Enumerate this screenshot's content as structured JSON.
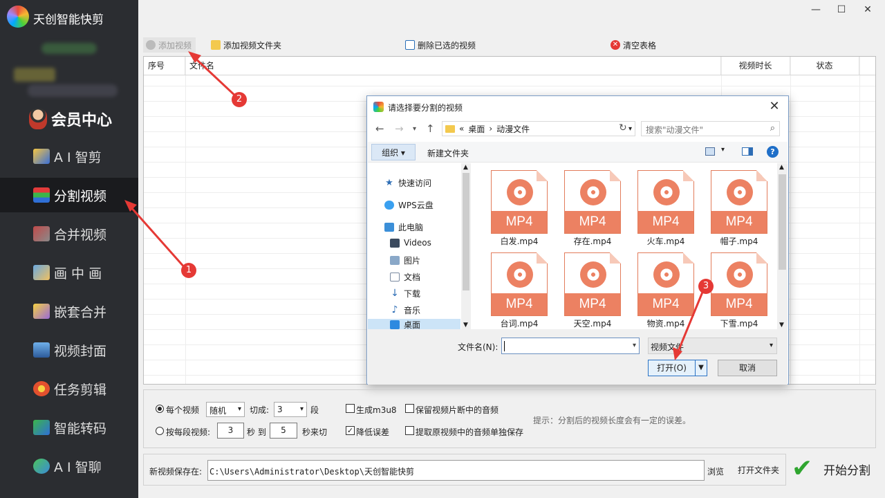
{
  "app": {
    "title": "天创智能快剪",
    "vip_label": "会员中心"
  },
  "window_controls": {
    "minimize": "—",
    "maximize": "☐",
    "close": "✕"
  },
  "sidebar": {
    "items": [
      {
        "label": "A I 智剪",
        "icon": "ai-cut-icon"
      },
      {
        "label": "分割视频",
        "icon": "split-video-icon",
        "active": true
      },
      {
        "label": "合并视频",
        "icon": "merge-video-icon"
      },
      {
        "label": "画 中 画",
        "icon": "picture-in-picture-icon"
      },
      {
        "label": "嵌套合并",
        "icon": "nested-merge-icon"
      },
      {
        "label": "视频封面",
        "icon": "video-cover-icon"
      },
      {
        "label": "任务剪辑",
        "icon": "task-edit-icon"
      },
      {
        "label": "智能转码",
        "icon": "transcode-icon"
      },
      {
        "label": "A I 智聊",
        "icon": "ai-chat-icon"
      }
    ]
  },
  "toolbar": {
    "add_video": "添加视频",
    "add_folder": "添加视频文件夹",
    "delete_selected": "删除已选的视频",
    "clear_table": "清空表格"
  },
  "table": {
    "columns": [
      "序号",
      "文件名",
      "视频时长",
      "状态"
    ]
  },
  "dialog": {
    "title": "请选择要分割的视频",
    "breadcrumb": {
      "prefix": "«",
      "parts": [
        "桌面",
        "动漫文件"
      ],
      "separator": "›"
    },
    "search_placeholder": "搜索\"动漫文件\"",
    "organize": "组织 ▾",
    "new_folder": "新建文件夹",
    "help": "?",
    "nav": [
      {
        "label": "快速访问",
        "icon": "star-icon"
      },
      {
        "label": "WPS云盘",
        "icon": "cloud-icon"
      },
      {
        "label": "此电脑",
        "icon": "computer-icon"
      },
      {
        "label": "Videos",
        "icon": "videos-folder-icon"
      },
      {
        "label": "图片",
        "icon": "pictures-folder-icon"
      },
      {
        "label": "文档",
        "icon": "documents-folder-icon"
      },
      {
        "label": "下载",
        "icon": "download-folder-icon"
      },
      {
        "label": "音乐",
        "icon": "music-folder-icon"
      },
      {
        "label": "桌面",
        "icon": "desktop-folder-icon",
        "selected": true
      }
    ],
    "file_badge": "MP4",
    "files": [
      "白发.mp4",
      "存在.mp4",
      "火车.mp4",
      "帽子.mp4",
      "台词.mp4",
      "天空.mp4",
      "物资.mp4",
      "下雪.mp4"
    ],
    "filename_label": "文件名(N):",
    "filename_value": "",
    "filetype": "视频文件",
    "open": "打开(O)",
    "cancel": "取消"
  },
  "options": {
    "per_video": "每个视频",
    "mode_value": "随机",
    "cut_into": "切成:",
    "segments_value": "3",
    "segments_unit": "段",
    "by_segment": "按每段视频:",
    "from_value": "3",
    "sec_to": "秒 到",
    "to_value": "5",
    "sec_cut": "秒来切",
    "gen_m3u8": "生成m3u8",
    "keep_audio": "保留视频片断中的音频",
    "reduce_error": "降低误差",
    "extract_audio": "提取原视频中的音频单独保存",
    "tip": "提示：分割后的视频长度会有一定的误差。",
    "checks": {
      "gen_m3u8": false,
      "keep_audio": false,
      "reduce_error": true,
      "extract_audio": false
    },
    "radio_selected": "per_video"
  },
  "save": {
    "label": "新视频保存在:",
    "path": "C:\\Users\\Administrator\\Desktop\\天创智能快剪",
    "browse": "浏览",
    "open_folder": "打开文件夹",
    "start": "开始分割"
  },
  "annotations": [
    "1",
    "2",
    "3"
  ],
  "colors": {
    "sidebar_bg": "#2b2d31",
    "active_item": "#1a1b1e",
    "mp4_accent": "#ec8162",
    "annotation_red": "#e53935",
    "start_check": "#2fa52f"
  }
}
